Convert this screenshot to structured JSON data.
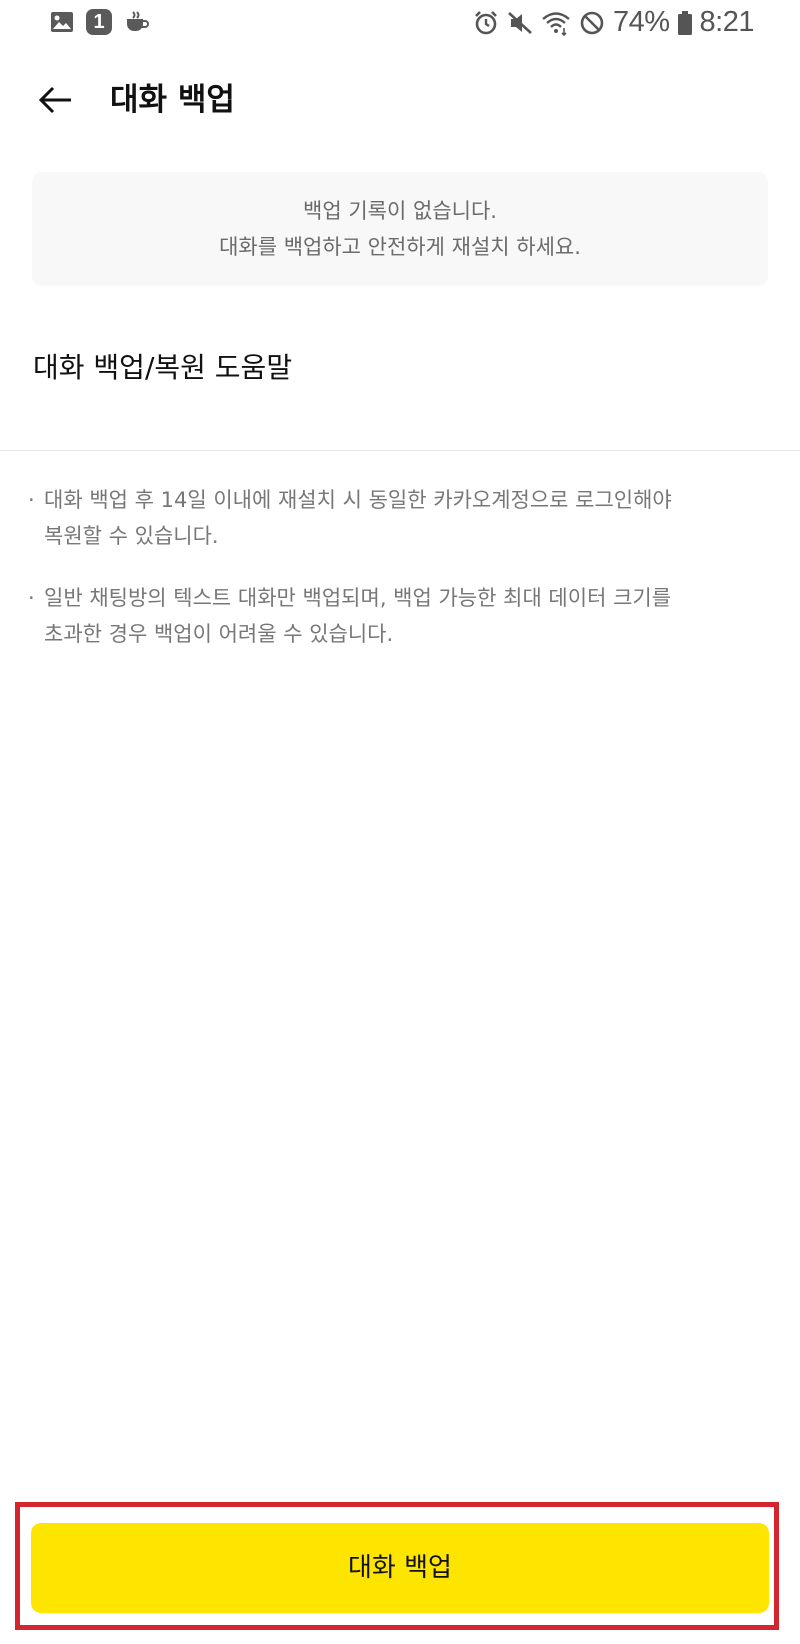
{
  "status_bar": {
    "battery": "74%",
    "time": "8:21",
    "notification_badge": "1",
    "icons_left": [
      "gallery-icon",
      "one-badge-icon",
      "coffee-icon"
    ],
    "icons_right": [
      "alarm-icon",
      "mute-icon",
      "wifi-icon",
      "blocked-icon",
      "battery-icon"
    ]
  },
  "header": {
    "title": "대화 백업"
  },
  "notice": {
    "line1": "백업 기록이 없습니다.",
    "line2": "대화를 백업하고 안전하게 재설치 하세요."
  },
  "help": {
    "title": "대화 백업/복원 도움말",
    "items": [
      {
        "bullet": "·",
        "line1": "대화 백업 후 14일 이내에 재설치 시 동일한 카카오계정으로 로그인해야",
        "line2": "복원할 수 있습니다."
      },
      {
        "bullet": "·",
        "line1": "일반 채팅방의 텍스트 대화만 백업되며, 백업 가능한 최대 데이터 크기를",
        "line2": "초과한 경우 백업이 어려울 수 있습니다."
      }
    ]
  },
  "primary_button": {
    "label": "대화 백업"
  },
  "colors": {
    "accent": "#fee500",
    "highlight_border": "#d3262f",
    "notice_bg": "#f8f8f8",
    "muted_text": "#777777"
  }
}
